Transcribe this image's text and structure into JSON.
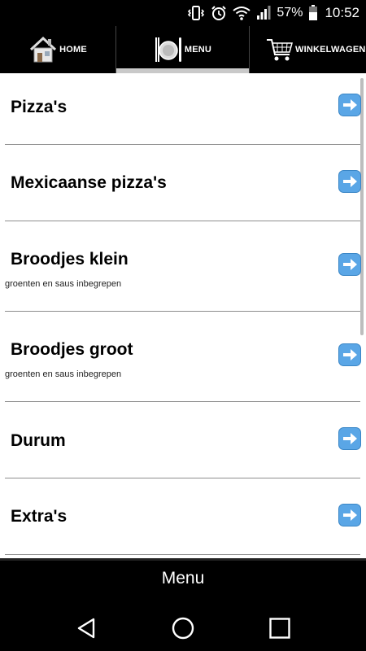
{
  "status": {
    "battery_percent": "57%",
    "time": "10:52",
    "icons": [
      "vibrate-icon",
      "alarm-icon",
      "wifi-icon",
      "signal-icon",
      "battery-icon"
    ]
  },
  "tabs": [
    {
      "label": "HOME",
      "icon": "home-icon",
      "active": false
    },
    {
      "label": "MENU",
      "icon": "plate-cutlery-icon",
      "active": true
    },
    {
      "label": "WINKELWAGEN",
      "icon": "shopping-cart-icon",
      "active": false
    }
  ],
  "menu": {
    "items": [
      {
        "title": "Pizza's",
        "subtitle": ""
      },
      {
        "title": "Mexicaanse pizza's",
        "subtitle": ""
      },
      {
        "title": "Broodjes klein",
        "subtitle": "groenten en saus inbegrepen"
      },
      {
        "title": "Broodjes groot",
        "subtitle": "groenten en saus inbegrepen"
      },
      {
        "title": "Durum",
        "subtitle": ""
      },
      {
        "title": "Extra's",
        "subtitle": ""
      }
    ]
  },
  "footer": {
    "title": "Menu"
  },
  "navbar": {
    "buttons": [
      "back-icon",
      "home-circle-icon",
      "recents-icon"
    ]
  },
  "colors": {
    "accent_arrow": "#5aa6e6",
    "tab_indicator": "#c9c9c9",
    "background": "#000000"
  }
}
